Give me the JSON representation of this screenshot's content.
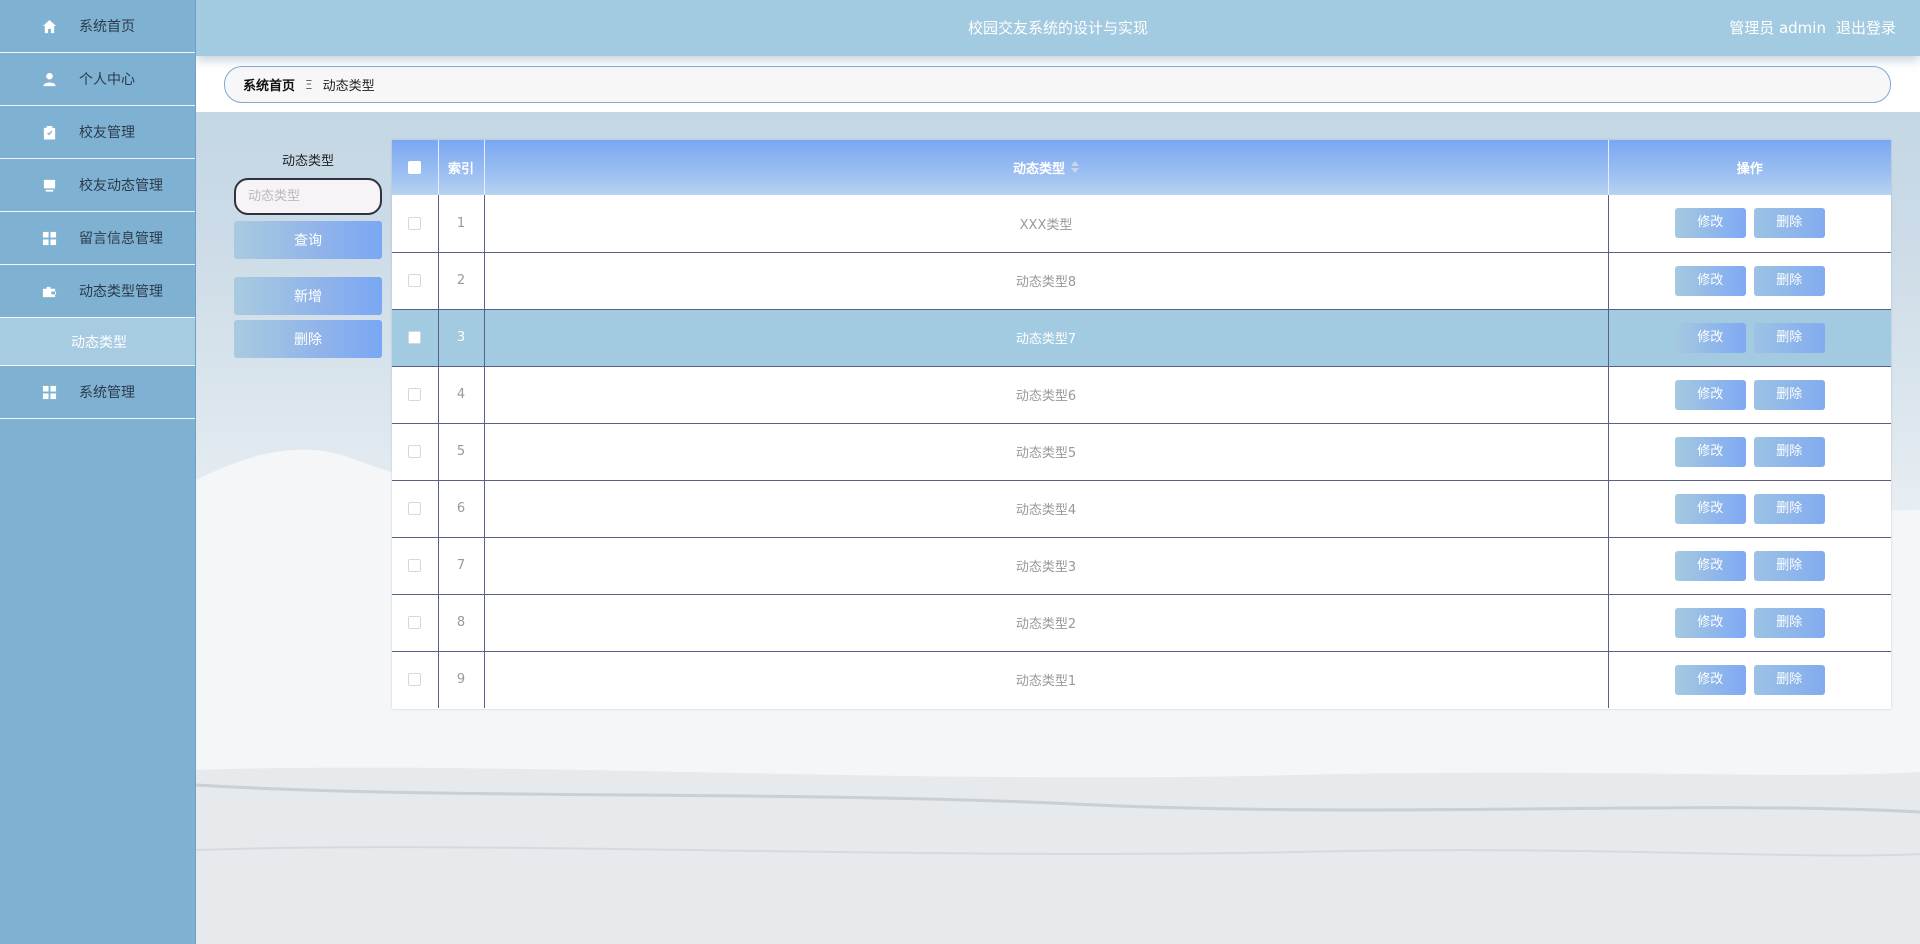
{
  "app": {
    "title": "校园交友系统的设计与实现",
    "user_label": "管理员 admin",
    "logout_label": "退出登录"
  },
  "sidebar": {
    "items": [
      {
        "label": "系统首页",
        "icon": "home-icon"
      },
      {
        "label": "个人中心",
        "icon": "user-icon"
      },
      {
        "label": "校友管理",
        "icon": "clipboard-icon"
      },
      {
        "label": "校友动态管理",
        "icon": "monitor-icon"
      },
      {
        "label": "留言信息管理",
        "icon": "grid-icon"
      },
      {
        "label": "动态类型管理",
        "icon": "briefcase-icon"
      },
      {
        "label": "系统管理",
        "icon": "grid-icon"
      }
    ],
    "active_sub": "动态类型"
  },
  "breadcrumb": {
    "home": "系统首页",
    "separator": "Ξ",
    "current": "动态类型"
  },
  "search": {
    "label": "动态类型",
    "placeholder": "动态类型",
    "query_button": "查询",
    "add_button": "新增",
    "delete_button": "删除"
  },
  "table": {
    "headers": {
      "index": "索引",
      "type": "动态类型",
      "actions": "操作"
    },
    "edit_label": "修改",
    "delete_label": "删除",
    "selected_row": 3,
    "rows": [
      {
        "index": "1",
        "type": "XXX类型"
      },
      {
        "index": "2",
        "type": "动态类型8"
      },
      {
        "index": "3",
        "type": "动态类型7"
      },
      {
        "index": "4",
        "type": "动态类型6"
      },
      {
        "index": "5",
        "type": "动态类型5"
      },
      {
        "index": "6",
        "type": "动态类型4"
      },
      {
        "index": "7",
        "type": "动态类型3"
      },
      {
        "index": "8",
        "type": "动态类型2"
      },
      {
        "index": "9",
        "type": "动态类型1"
      }
    ]
  },
  "colors": {
    "sidebar_bg": "#7fb1d3",
    "header_bg": "#a2cae0",
    "accent": "#7aa7f5",
    "row_border": "#5a5f89"
  }
}
